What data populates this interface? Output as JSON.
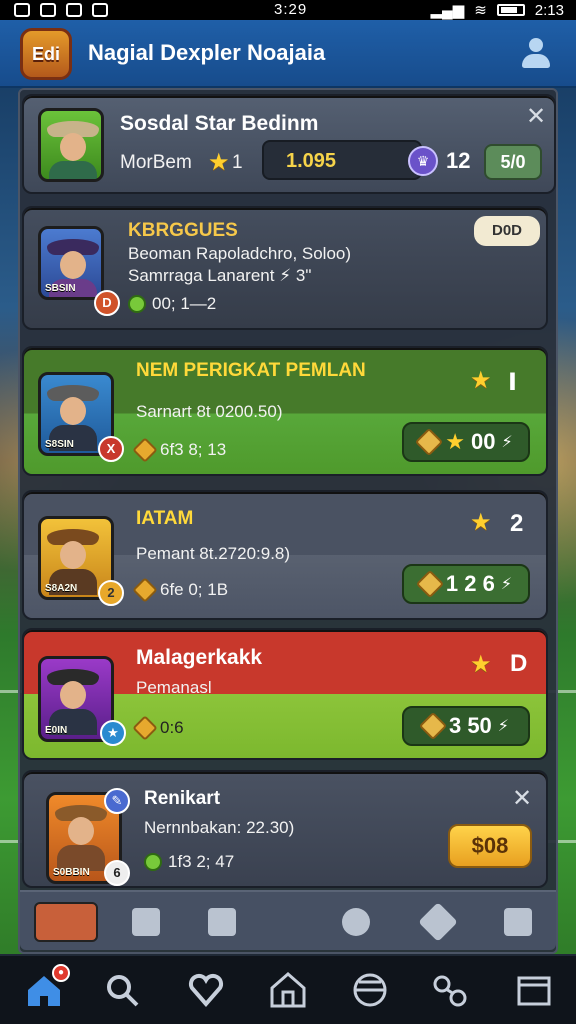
{
  "status_bar": {
    "time_center": "3:29",
    "time_right": "2:13"
  },
  "app": {
    "title": "Nagial Dexpler Noajaia",
    "logo_text": "Edi"
  },
  "summary_card": {
    "title": "Sosdal Star Bedinm",
    "member_label": "MorBem",
    "member_stars": "1",
    "score": "1.095",
    "count": "12",
    "badge": "5/0"
  },
  "cards": [
    {
      "title": "KBRGGUES",
      "line1": "Beoman Rapoladchro, Soloo)",
      "line2": "Samrraga Lanarent ⚡ 3ʺ",
      "stats": "00; 1—2",
      "tag": "SBSIN",
      "badge_corner": "D",
      "chip": "D0D"
    },
    {
      "title": "NEM PERIGKAT PEMLAN",
      "line1": "Sarnart 8t 0200.50)",
      "stats": "6f3 8; 13",
      "tag": "S8SIN",
      "badge_corner": "X",
      "rank": "Ⅰ",
      "pill": "00"
    },
    {
      "title": "IATAM",
      "line1": "Pemant 8t.2720:9.8)",
      "stats": "6fe 0; 1B",
      "tag": "S8A2N",
      "badge_corner": "2",
      "rank": "2",
      "pill": "1 2 6"
    },
    {
      "title": "Malagerkakk",
      "line1": "Pemanasl",
      "stats": "0:6",
      "tag": "E0IN",
      "badge_corner": "★",
      "rank": "D",
      "pill": "3 50"
    },
    {
      "title": "Renikart",
      "line1": "Nernnbakan: 22.30)",
      "stats": "1f3 2; 47",
      "tag": "S0BBIN",
      "badge_corner": "6",
      "pill": "$08"
    }
  ],
  "colors": {
    "card_dark": "#3b4453",
    "card_green": "#4f9a2c",
    "card_red": "#c8382c",
    "accent_gold": "#ffcf2e"
  },
  "icons": [
    "user-icon",
    "close-icon",
    "star-icon",
    "gem-icon",
    "home-icon",
    "search-icon",
    "heart-icon",
    "house-icon",
    "globe-icon",
    "link-icon",
    "card-icon"
  ]
}
